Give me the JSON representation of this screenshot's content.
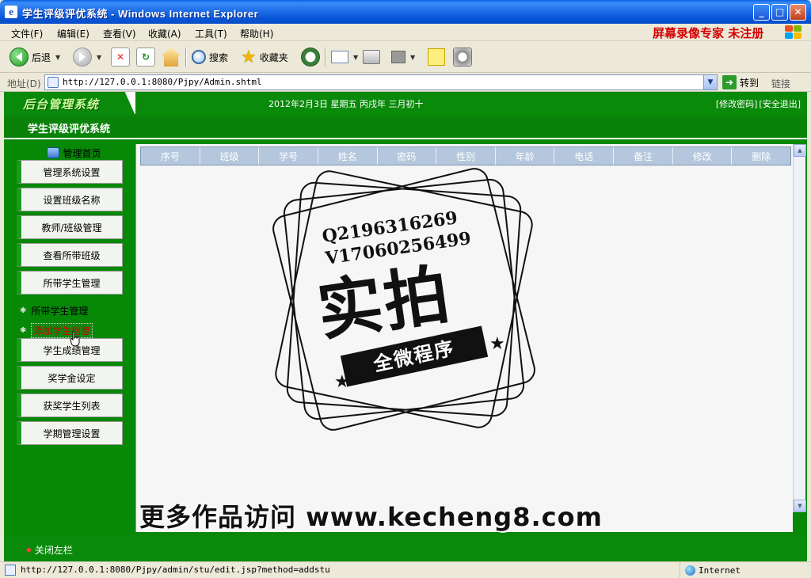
{
  "window": {
    "title": "学生评级评优系统 - Windows Internet Explorer",
    "app_icon": "e"
  },
  "menu": {
    "items": [
      "文件(F)",
      "编辑(E)",
      "查看(V)",
      "收藏(A)",
      "工具(T)",
      "帮助(H)"
    ],
    "watermark": "屏幕录像专家  未注册"
  },
  "toolbar": {
    "back_label": "后退",
    "search_label": "搜索",
    "favorites_label": "收藏夹"
  },
  "address": {
    "label": "地址(D)",
    "url": "http://127.0.0.1:8080/Pjpy/Admin.shtml",
    "go_label": "转到",
    "links_label": "链接"
  },
  "header": {
    "logo_text": "后台管理系统",
    "date_text": "2012年2月3日 星期五 丙戌年 三月初十",
    "change_password": "[修改密码]",
    "logout": "[安全退出]",
    "system_title": "学生评级评优系统"
  },
  "sidebar": {
    "home_label": "管理首页",
    "buttons_top": [
      "管理系统设置",
      "设置班级名称",
      "教师/班级管理",
      "查看所带班级",
      "所带学生管理"
    ],
    "sub_items": [
      "所带学生管理",
      "添加学生信息"
    ],
    "buttons_bottom": [
      "学生成绩管理",
      "奖学金设定",
      "获奖学生列表",
      "学期管理设置"
    ],
    "close_label": "关闭左栏"
  },
  "table": {
    "columns": [
      "序号",
      "班级",
      "学号",
      "姓名",
      "密码",
      "性别",
      "年龄",
      "电话",
      "备注",
      "修改",
      "删除"
    ]
  },
  "overlay": {
    "qq_line1": "Q2196316269",
    "qq_line2": "V17060256499",
    "big_text": "实拍",
    "ribbon_text": "全微程序",
    "promo_text": "更多作品访问 www.kecheng8.com"
  },
  "status": {
    "url": "http://127.0.0.1:8080/Pjpy/admin/stu/edit.jsp?method=addstu",
    "zone": "Internet"
  },
  "colors": {
    "page_green": "#078807",
    "titlebar_blue": "#1f6ee8",
    "watermark_red": "#d40000",
    "active_sub_red": "#d40000"
  }
}
